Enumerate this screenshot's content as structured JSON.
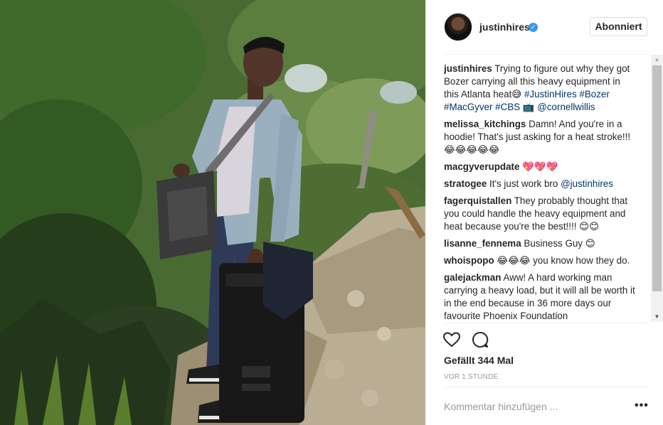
{
  "post": {
    "username": "justinhires",
    "verified_icon": "verified-badge-icon",
    "follow_label": "Abonniert",
    "likes": "Gefällt 344 Mal",
    "time": "VOR 1 STUNDE",
    "comment_placeholder": "Kommentar hinzufügen ...",
    "more_label": "•••"
  },
  "photo": {
    "description_icon": "photo-man-with-equipment"
  },
  "comments": [
    {
      "user": "justinhires",
      "text": "Trying to figure out why they got Bozer carrying all this heavy equipment in this Atlanta heat😅 ",
      "links": "#JustinHires #Bozer #MacGyver #CBS 📺 @cornellwillis"
    },
    {
      "user": "melissa_kitchings",
      "text": "Damn! And you're in a hoodie! That's just asking for a heat stroke!!! 😂😂😂😂😂",
      "links": ""
    },
    {
      "user": "macgyverupdate",
      "text": "💖💖💖",
      "links": ""
    },
    {
      "user": "stratogee",
      "text": "It's just work bro ",
      "links": "@justinhires"
    },
    {
      "user": "fagerquistallen",
      "text": "They probably thought that you could handle the heavy equipment and heat because you're the best!!!! 😊😊",
      "links": ""
    },
    {
      "user": "lisanne_fennema",
      "text": "Business Guy 😊",
      "links": ""
    },
    {
      "user": "whoispopo",
      "text": "😂😂😂 you know how they do.",
      "links": ""
    },
    {
      "user": "galejackman",
      "text": "Aww! A hard working man carrying a heavy load, but it will all be worth it in the end because in 36 more days our favourite Phoenix Foundation",
      "links": ""
    }
  ],
  "icons": {
    "like": "heart-icon",
    "comment": "comment-bubble-icon",
    "scroll_up": "scroll-up-arrow-icon",
    "scroll_down": "scroll-down-arrow-icon"
  },
  "colors": {
    "link": "#003569",
    "verified": "#3897f0",
    "muted": "#999999"
  }
}
